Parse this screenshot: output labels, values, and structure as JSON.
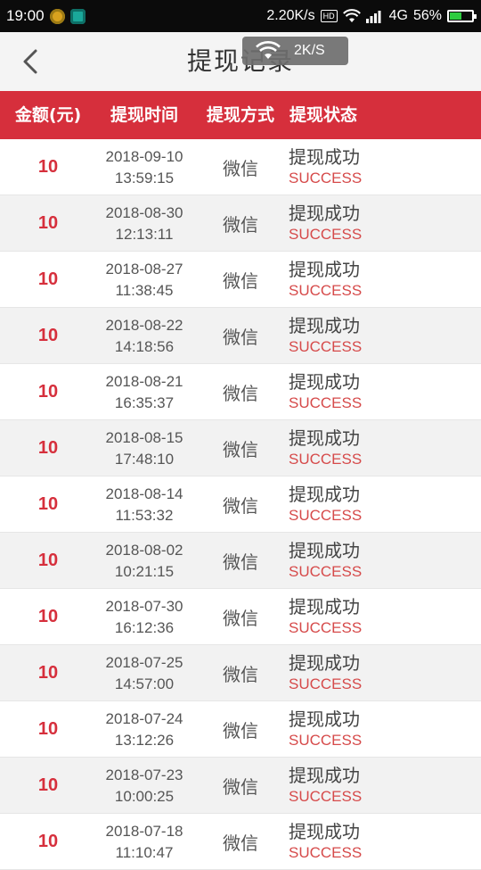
{
  "status_bar": {
    "time": "19:00",
    "net_speed": "2.20K/s",
    "hd": "HD",
    "network": "4G",
    "battery_pct": "56%",
    "battery_level": 0.56,
    "icons": [
      "app-notification-icon",
      "app-screenshot-icon",
      "wifi-icon",
      "signal-icon",
      "battery-charging-icon"
    ]
  },
  "header": {
    "title": "提现记录",
    "back_icon": "chevron-left-icon"
  },
  "toast": {
    "speed": "2K/S",
    "icon": "wifi-icon"
  },
  "table": {
    "columns": [
      "金额(元)",
      "提现时间",
      "提现方式",
      "提现状态"
    ],
    "rows": [
      {
        "amount": "10",
        "date": "2018-09-10",
        "time": "13:59:15",
        "method": "微信",
        "status": "提现成功",
        "status_code": "SUCCESS"
      },
      {
        "amount": "10",
        "date": "2018-08-30",
        "time": "12:13:11",
        "method": "微信",
        "status": "提现成功",
        "status_code": "SUCCESS"
      },
      {
        "amount": "10",
        "date": "2018-08-27",
        "time": "11:38:45",
        "method": "微信",
        "status": "提现成功",
        "status_code": "SUCCESS"
      },
      {
        "amount": "10",
        "date": "2018-08-22",
        "time": "14:18:56",
        "method": "微信",
        "status": "提现成功",
        "status_code": "SUCCESS"
      },
      {
        "amount": "10",
        "date": "2018-08-21",
        "time": "16:35:37",
        "method": "微信",
        "status": "提现成功",
        "status_code": "SUCCESS"
      },
      {
        "amount": "10",
        "date": "2018-08-15",
        "time": "17:48:10",
        "method": "微信",
        "status": "提现成功",
        "status_code": "SUCCESS"
      },
      {
        "amount": "10",
        "date": "2018-08-14",
        "time": "11:53:32",
        "method": "微信",
        "status": "提现成功",
        "status_code": "SUCCESS"
      },
      {
        "amount": "10",
        "date": "2018-08-02",
        "time": "10:21:15",
        "method": "微信",
        "status": "提现成功",
        "status_code": "SUCCESS"
      },
      {
        "amount": "10",
        "date": "2018-07-30",
        "time": "16:12:36",
        "method": "微信",
        "status": "提现成功",
        "status_code": "SUCCESS"
      },
      {
        "amount": "10",
        "date": "2018-07-25",
        "time": "14:57:00",
        "method": "微信",
        "status": "提现成功",
        "status_code": "SUCCESS"
      },
      {
        "amount": "10",
        "date": "2018-07-24",
        "time": "13:12:26",
        "method": "微信",
        "status": "提现成功",
        "status_code": "SUCCESS"
      },
      {
        "amount": "10",
        "date": "2018-07-23",
        "time": "10:00:25",
        "method": "微信",
        "status": "提现成功",
        "status_code": "SUCCESS"
      },
      {
        "amount": "10",
        "date": "2018-07-18",
        "time": "11:10:47",
        "method": "微信",
        "status": "提现成功",
        "status_code": "SUCCESS"
      }
    ]
  },
  "colors": {
    "accent": "#d62f3c",
    "row_alt": "#f2f2f2",
    "status_code": "#d64a4a"
  }
}
